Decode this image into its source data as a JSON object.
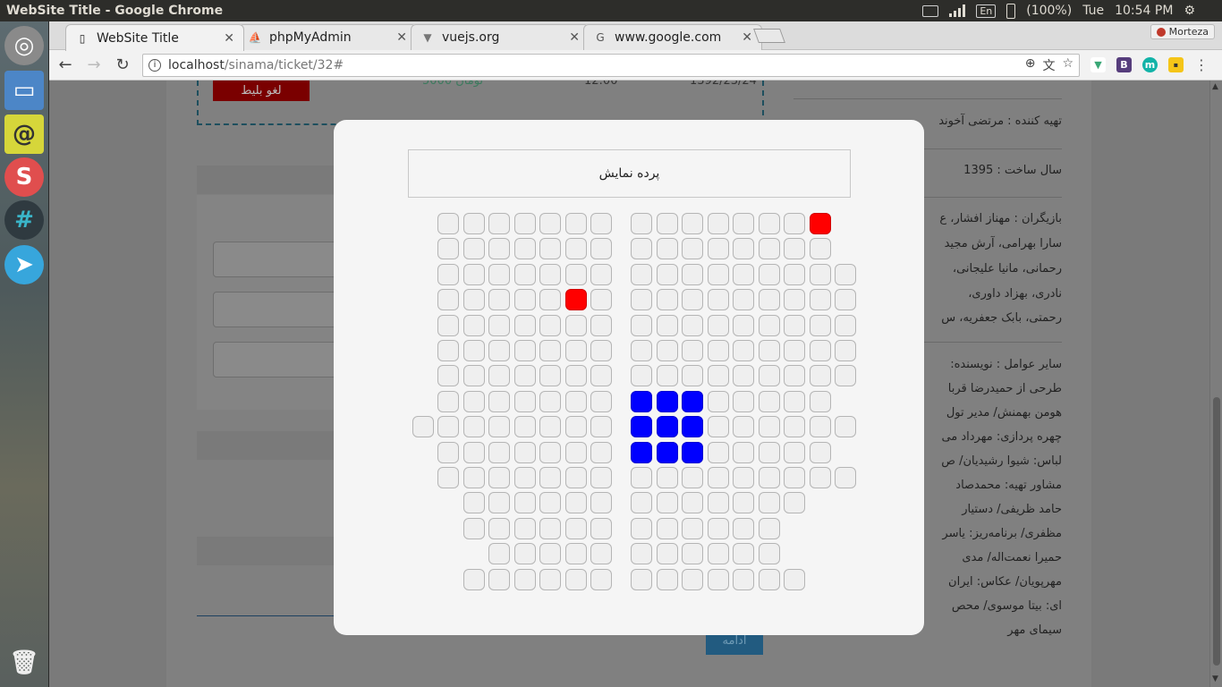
{
  "system": {
    "window_title": "WebSite Title - Google Chrome",
    "language": "En",
    "battery": "(100%)",
    "day": "Tue",
    "time": "10:54 PM"
  },
  "browser": {
    "tabs": [
      {
        "label": "WebSite Title",
        "icon": "page-icon",
        "active": true
      },
      {
        "label": "phpMyAdmin",
        "icon": "phpmyadmin-icon",
        "active": false
      },
      {
        "label": "vuejs.org",
        "icon": "vue-icon",
        "active": false
      },
      {
        "label": "www.google.com",
        "icon": "google-icon",
        "active": false
      }
    ],
    "profile_name": "Morteza",
    "url_host": "localhost",
    "url_path": "/sinama/ticket/32#"
  },
  "page": {
    "ticket": {
      "cancel_label": "لغو بلیط",
      "price": "5000 تومان",
      "time": "12:00",
      "date": "1392/23/24"
    },
    "continue_label": "ادامه",
    "info": {
      "producer": "تهیه کننده : مرتضی آخوند",
      "year": "سال ساخت : 1395",
      "cast_1": "بازیگران : مهناز افشار، ع",
      "cast_2": "سارا بهرامی، آرش مجید",
      "cast_3": "رحمانی، مانیا علیجانی،",
      "cast_4": "نادری، بهزاد داوری، ",
      "cast_5": "رحمتی، بابک جعفریه، س",
      "crew_1": "سایر عوامل : نویسنده:",
      "crew_2": "طرحی از حمیدرضا قربا",
      "crew_3": "هومن بهمنش/ مدیر تول",
      "crew_4": "چهره پردازی: مهرداد می",
      "crew_5": "لباس: شیوا رشیدیان/ ص",
      "crew_6": "مشاور تهیه: محمدصاد",
      "crew_7": "حامد ظریفی/ دستیار",
      "crew_8": "مظفری/ برنامه‌ریز: یاسر",
      "crew_9": "حمیرا نعمت‌اله/ مدی",
      "crew_10": "مهرپویان/ عکاس: ایران",
      "crew_11": "ای: بیتا موسوی/ محص",
      "crew_12": "سیمای مهر"
    }
  },
  "modal": {
    "screen_label": "پرده نمایش",
    "seat_map": {
      "rows": 15,
      "left_block_columns": 7,
      "right_block_columns": 9,
      "legend_colors": {
        "available": "#efefef",
        "reserved": "#ff0000",
        "selected": "#0000ff"
      },
      "row_layout": [
        {
          "left_start": 0,
          "left_count": 7,
          "right_start": 0,
          "right_count": 8
        },
        {
          "left_start": 0,
          "left_count": 7,
          "right_start": 0,
          "right_count": 8
        },
        {
          "left_start": 0,
          "left_count": 7,
          "right_start": 0,
          "right_count": 9
        },
        {
          "left_start": 0,
          "left_count": 7,
          "right_start": 0,
          "right_count": 9
        },
        {
          "left_start": 0,
          "left_count": 7,
          "right_start": 0,
          "right_count": 9
        },
        {
          "left_start": 0,
          "left_count": 7,
          "right_start": 0,
          "right_count": 9
        },
        {
          "left_start": 0,
          "left_count": 7,
          "right_start": 0,
          "right_count": 9
        },
        {
          "left_start": 0,
          "left_count": 7,
          "right_start": 0,
          "right_count": 8
        },
        {
          "left_start": -1,
          "left_count": 8,
          "right_start": 0,
          "right_count": 9
        },
        {
          "left_start": 0,
          "left_count": 7,
          "right_start": 0,
          "right_count": 8
        },
        {
          "left_start": 0,
          "left_count": 7,
          "right_start": 0,
          "right_count": 9
        },
        {
          "left_start": 1,
          "left_count": 6,
          "right_start": 0,
          "right_count": 7
        },
        {
          "left_start": 1,
          "left_count": 6,
          "right_start": 0,
          "right_count": 6
        },
        {
          "left_start": 2,
          "left_count": 5,
          "right_start": 0,
          "right_count": 6
        },
        {
          "left_start": 1,
          "left_count": 6,
          "right_start": 0,
          "right_count": 7
        }
      ],
      "reserved": [
        {
          "row": 0,
          "block": "right",
          "col": 7
        },
        {
          "row": 3,
          "block": "left",
          "col": 5
        }
      ],
      "selected": [
        {
          "row": 7,
          "block": "right",
          "col": 0
        },
        {
          "row": 7,
          "block": "right",
          "col": 1
        },
        {
          "row": 7,
          "block": "right",
          "col": 2
        },
        {
          "row": 8,
          "block": "right",
          "col": 0
        },
        {
          "row": 8,
          "block": "right",
          "col": 1
        },
        {
          "row": 8,
          "block": "right",
          "col": 2
        },
        {
          "row": 9,
          "block": "right",
          "col": 0
        },
        {
          "row": 9,
          "block": "right",
          "col": 1
        },
        {
          "row": 9,
          "block": "right",
          "col": 2
        }
      ]
    }
  }
}
